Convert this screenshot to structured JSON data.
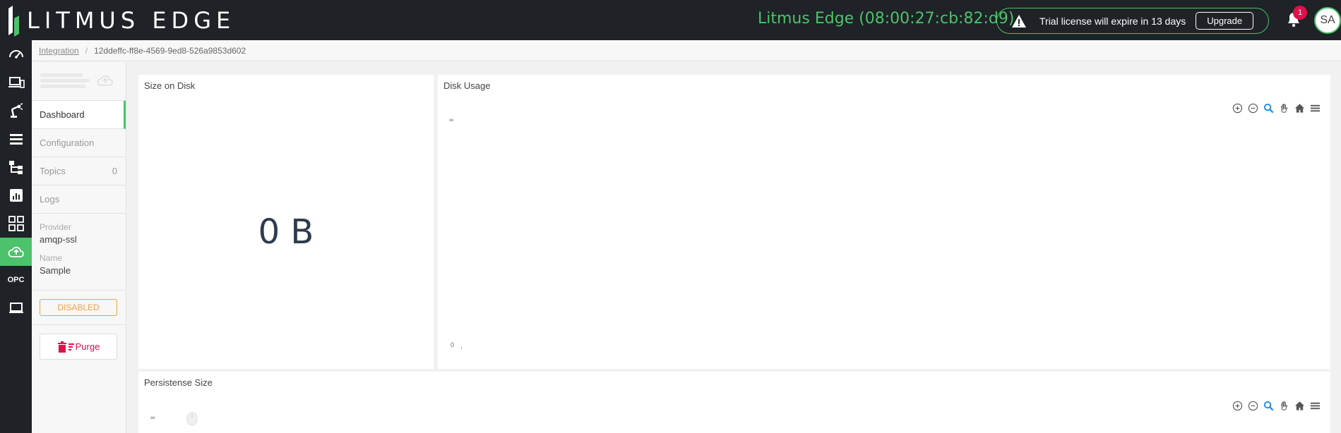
{
  "header": {
    "logo_text": "LITMUS EDGE",
    "device_label": "Litmus Edge (08:00:27:cb:82:d9)",
    "trial_text": "Trial license will expire in 13 days",
    "upgrade_label": "Upgrade",
    "notification_count": "1",
    "avatar_initials": "SA"
  },
  "breadcrumb": {
    "parent": "Integration",
    "separator": "/",
    "current": "12ddeffc-ff8e-4569-9ed8-526a9853d602"
  },
  "sidebar": {
    "items": [
      {
        "label": "Dashboard"
      },
      {
        "label": "Configuration"
      },
      {
        "label": "Topics",
        "count": "0"
      },
      {
        "label": "Logs"
      }
    ],
    "provider_label": "Provider",
    "provider_value": "amqp-ssl",
    "name_label": "Name",
    "name_value": "Sample",
    "status": "DISABLED",
    "purge_label": "Purge"
  },
  "panels": {
    "size_on_disk": {
      "title": "Size on Disk",
      "value": "0 B"
    },
    "disk_usage": {
      "title": "Disk Usage",
      "y_top_tick": "∞",
      "y_bottom_tick": "0"
    },
    "persistence_size": {
      "title": "Persistense Size",
      "y_top_tick": "∞"
    }
  },
  "nav_icons": [
    "dashboard-icon",
    "devices-icon",
    "robot-arm-icon",
    "list-icon",
    "flows-icon",
    "analytics-icon",
    "apps-icon",
    "cloud-upload-icon",
    "opc-icon",
    "laptop-icon"
  ],
  "colors": {
    "accent": "#4cc26a",
    "topbar": "#1f2227",
    "danger": "#e0104b",
    "warning": "#f0a14a"
  }
}
